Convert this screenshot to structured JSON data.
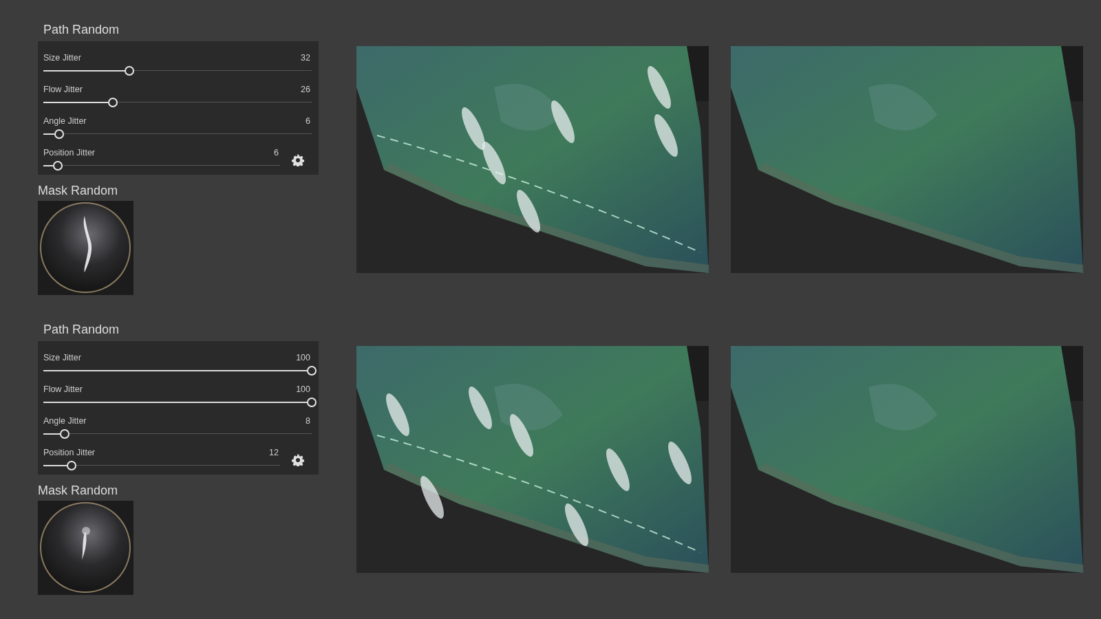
{
  "sections": [
    {
      "path_random": {
        "title": "Path Random",
        "sliders": [
          {
            "label": "Size Jitter",
            "value": "32",
            "level": 0.32,
            "kind": "plain"
          },
          {
            "label": "Flow Jitter",
            "value": "26",
            "level": 0.26,
            "kind": "plain"
          },
          {
            "label": "Angle Jitter",
            "value": "6",
            "level": 0.06,
            "kind": "plain"
          },
          {
            "label": "Position Jitter",
            "value": "6",
            "level": 0.06,
            "kind": "settings"
          }
        ]
      },
      "mask_random": {
        "title": "Mask Random"
      }
    },
    {
      "path_random": {
        "title": "Path Random",
        "sliders": [
          {
            "label": "Size Jitter",
            "value": "100",
            "level": 1,
            "kind": "plain"
          },
          {
            "label": "Flow Jitter",
            "value": "100",
            "level": 1,
            "kind": "plain"
          },
          {
            "label": "Angle Jitter",
            "value": "8",
            "level": 0.08,
            "kind": "plain"
          },
          {
            "label": "Position Jitter",
            "value": "12",
            "level": 0.12,
            "kind": "settings"
          }
        ]
      },
      "mask_random": {
        "title": "Mask Random"
      }
    }
  ]
}
